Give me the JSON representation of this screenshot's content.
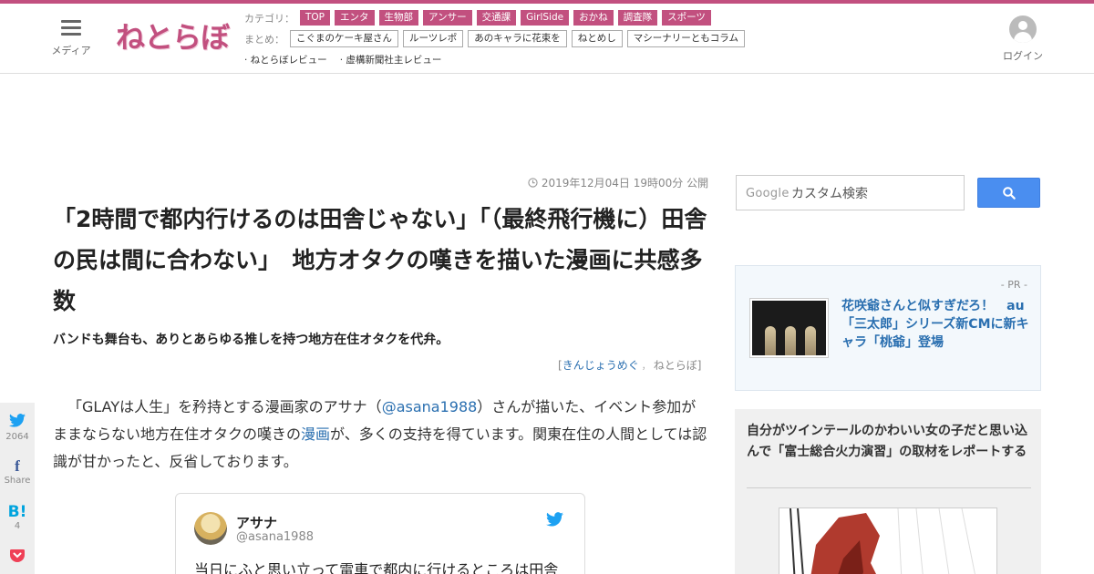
{
  "header": {
    "media_label": "メディア",
    "logo_text": "ねとらぼ",
    "category_label": "カテゴリ：",
    "categories": [
      "TOP",
      "エンタ",
      "生物部",
      "アンサー",
      "交通課",
      "GirlSide",
      "おかね",
      "調査隊",
      "スポーツ"
    ],
    "matome_label": "まとめ：",
    "matome": [
      "こぐまのケーキ屋さん",
      "ルーツレポ",
      "あのキャラに花束を",
      "ねとめし",
      "マシーナリーともコラム"
    ],
    "sub_links": [
      "· ねとらぼレビュー",
      "· 虚構新聞社主レビュー"
    ],
    "login_label": "ログイン",
    "accent_color": "#c2507f"
  },
  "share": {
    "twitter_count": "2064",
    "facebook_label": "Share",
    "hatena_label": "B!",
    "hatena_count": "4"
  },
  "article": {
    "date": "2019年12月04日 19時00分 公開",
    "title": "「2時間で都内行けるのは田舎じゃない」「（最終飛行機に）田舎の民は間に合わない」　地方オタクの嘆きを描いた漫画に共感多数",
    "subtitle": "バンドも舞台も、ありとあらゆる推しを持つ地方在住オタクを代弁。",
    "byline_open": "[",
    "author": "きんじょうめぐ",
    "byline_sep": "，",
    "site": "ねとらぼ",
    "byline_close": "]",
    "lead_1": "「GLAYは人生」を矜持とする漫画家のアサナ（",
    "lead_handle": "@asana1988",
    "lead_2": "）さんが描いた、イベント参加がままならない地方在住オタクの嘆きの",
    "lead_link": "漫画",
    "lead_3": "が、多くの支持を得ています。関東在住の人間としては認識が甘かったと、反省しております。"
  },
  "tweet": {
    "name": "アサナ",
    "handle": "@asana1988",
    "text": "当日にふと思い立って電車で都内に行けるところは田舎"
  },
  "sidebar": {
    "search_placeholder": "カスタム検索",
    "google_label": "Google",
    "pr_label": "- PR -",
    "pr_text": "花咲爺さんと似すぎだろ！　au「三太郎」シリーズ新CMに新キャラ「桃爺」登場",
    "feature_title": "自分がツインテールのかわいい女の子だと思い込んで「富士総合火力演習」の取材をレポートする"
  }
}
